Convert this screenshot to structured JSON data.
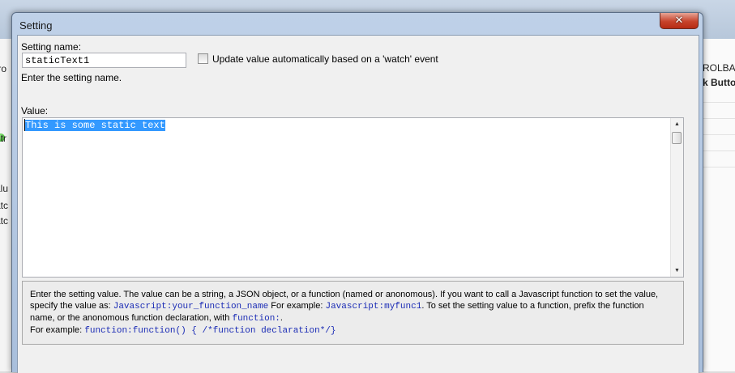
{
  "background": {
    "left_fragments": [
      "tro",
      "ntr",
      "alu",
      "atc",
      "atc"
    ],
    "right_fragments": [
      "ROLBAR",
      "k Butto"
    ]
  },
  "dialog": {
    "title": "Setting",
    "close_glyph": "✕",
    "setting_name": {
      "label": "Setting name:",
      "value": "staticText1",
      "hint": "Enter the setting name."
    },
    "watch_checkbox": {
      "label": "Update value automatically based on a 'watch' event",
      "checked": false
    },
    "value": {
      "label": "Value:",
      "text": "This is some static text"
    },
    "help": {
      "line1_a": "Enter the setting value. The value can be a string, a JSON object, or a function (named or anonomous). If you want to call a Javascript function to set the value,",
      "line2_a": "specify the value as: ",
      "line2_code1": "Javascript:your_function_name",
      "line2_b": " For example: ",
      "line2_code2": "Javascript:myfunc1",
      "line2_c": ". To set the setting value to a function, prefix the function",
      "line3_a": "name, or the anonomous function declaration, with ",
      "line3_code": "function:",
      "line3_b": ".",
      "line4_a": "For example: ",
      "line4_code": "function:function() { /*function declaration*/}"
    }
  },
  "colors": {
    "selection": "#3399ff",
    "code_text": "#1a2bb5",
    "close_button": "#c7432b"
  }
}
